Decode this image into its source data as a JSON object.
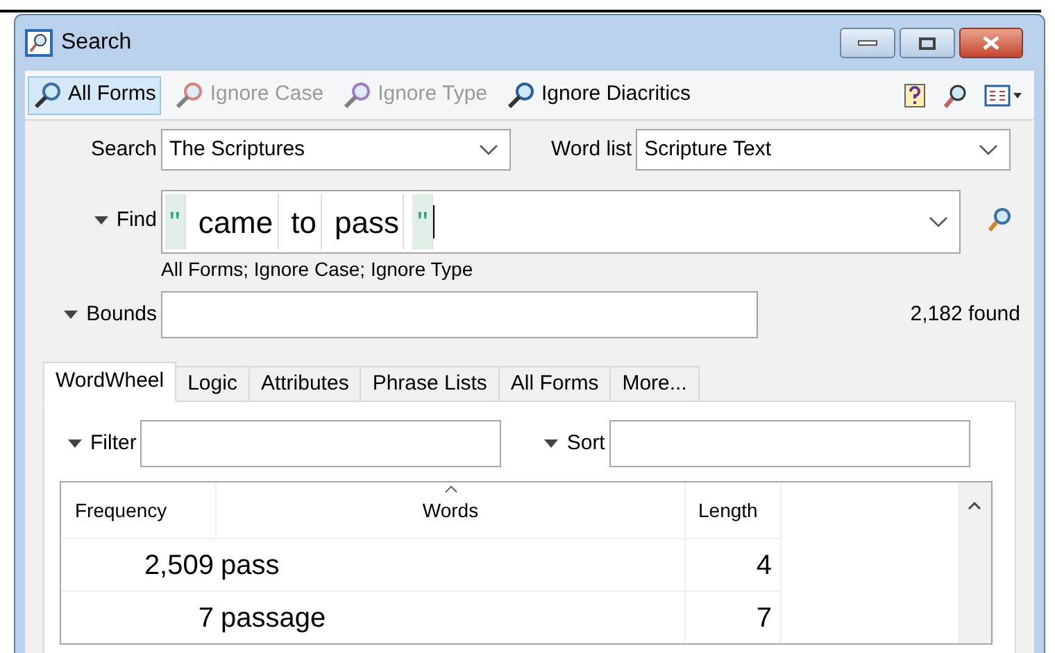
{
  "window": {
    "title": "Search"
  },
  "toolbar": [
    {
      "label": "All Forms",
      "selected": true,
      "disabled": false
    },
    {
      "label": "Ignore Case",
      "selected": false,
      "disabled": true
    },
    {
      "label": "Ignore Type",
      "selected": false,
      "disabled": true
    },
    {
      "label": "Ignore Diacritics",
      "selected": false,
      "disabled": false
    }
  ],
  "search": {
    "label": "Search",
    "value": "The Scriptures"
  },
  "word_list": {
    "label": "Word list",
    "value": "Scripture Text"
  },
  "find": {
    "label": "Find",
    "expanded": true,
    "tokens": [
      {
        "kind": "quote",
        "text": "\""
      },
      {
        "kind": "word",
        "text": "came"
      },
      {
        "kind": "word",
        "text": "to"
      },
      {
        "kind": "word",
        "text": "pass"
      },
      {
        "kind": "quote",
        "text": "\""
      }
    ],
    "options": "All Forms; Ignore Case; Ignore Type"
  },
  "bounds": {
    "label": "Bounds",
    "expanded": true,
    "count": "2,182 found"
  },
  "tabs": [
    {
      "label": "WordWheel",
      "selected": true
    },
    {
      "label": "Logic",
      "selected": false
    },
    {
      "label": "Attributes",
      "selected": false
    },
    {
      "label": "Phrase Lists",
      "selected": false
    },
    {
      "label": "All Forms",
      "selected": false
    },
    {
      "label": "More...",
      "selected": false
    }
  ],
  "filter": {
    "label": "Filter"
  },
  "sort": {
    "label": "Sort"
  },
  "table": {
    "columns": [
      "Frequency",
      "Words",
      "Length"
    ],
    "rows": [
      [
        "2,509",
        "pass",
        "4"
      ],
      [
        "7",
        "passage",
        "7"
      ]
    ]
  }
}
